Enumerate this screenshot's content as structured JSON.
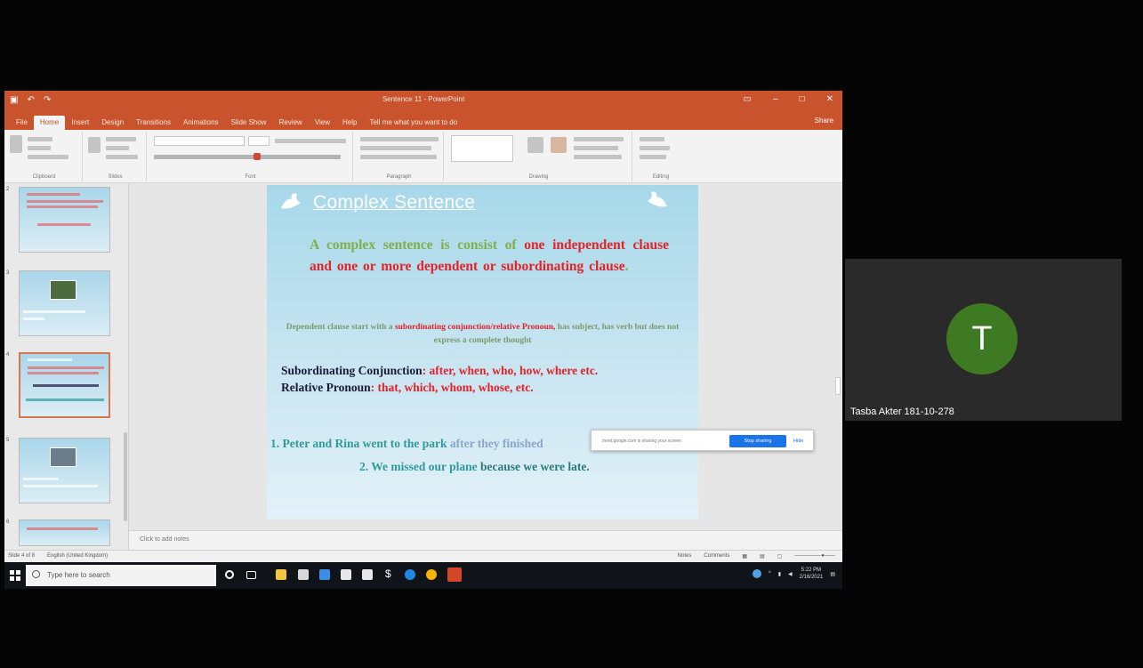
{
  "powerpoint": {
    "window_title": "Sentence 11 - PowerPoint",
    "ribbon_tabs": [
      "File",
      "Home",
      "Insert",
      "Design",
      "Transitions",
      "Animations",
      "Slide Show",
      "Review",
      "View",
      "Help",
      "Tell me what you want to do"
    ],
    "active_tab": "Home",
    "share_label": "Share",
    "ribbon_groups": [
      "Clipboard",
      "Slides",
      "Font",
      "Paragraph",
      "Drawing",
      "Editing"
    ],
    "notes_placeholder": "Click to add notes",
    "status_left": [
      "Slide 4 of 8",
      "English (United Kingdom)"
    ],
    "status_right": [
      "Notes",
      "Comments"
    ]
  },
  "slide": {
    "title": "Complex Sentence",
    "def_1": "A complex sentence is consist of ",
    "def_2": "one independent clause and one or more dependent or subordinating clause",
    "def_3": ".",
    "sub_1": "Dependent clause start with a ",
    "sub_2": "subordinating conjunction/relative Pronoun,",
    "sub_3": " has subject, has verb but does not express a complete thought",
    "conj_label": "Subordinating Conjunction",
    "conj_values": ": after, when, who, how, where etc.",
    "rel_label": "Relative Pronoun",
    "rel_values": ": that, which, whom, whose, etc.",
    "ex1_a": "1. Peter and Rina went to the park ",
    "ex1_b": "after they finished",
    "ex2_a": "2. We missed our plane ",
    "ex2_b": "because we were late."
  },
  "sharing_popup": {
    "message": "meet.google.com is sharing your screen.",
    "stop_label": "Stop sharing",
    "hide_label": "Hide"
  },
  "taskbar": {
    "search_placeholder": "Type here to search",
    "clock_time": "5:22 PM",
    "clock_date": "2/16/2021"
  },
  "participant": {
    "initial": "T",
    "name": "Tasba Akter 181-10-278",
    "avatar_color": "#3d7a22"
  },
  "colors": {
    "powerpoint_accent": "#c9532c",
    "slide_red": "#e2232a",
    "slide_green": "#7fb04a"
  }
}
